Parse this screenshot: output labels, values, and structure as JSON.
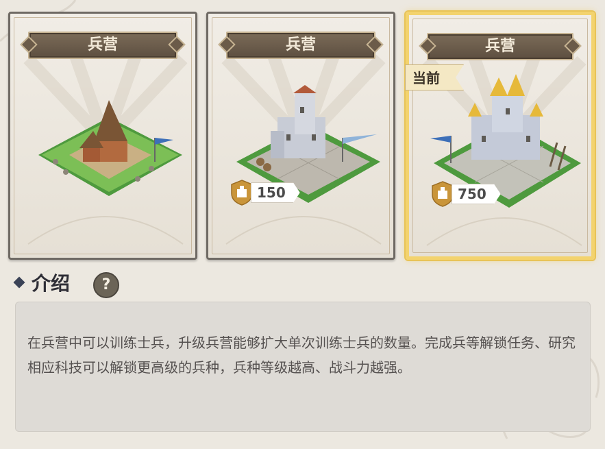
{
  "cards": [
    {
      "title": "兵营",
      "building": "barracks-level-1-icon",
      "cost": null,
      "current": false
    },
    {
      "title": "兵营",
      "building": "barracks-level-2-icon",
      "cost": "150",
      "current": false
    },
    {
      "title": "兵营",
      "building": "barracks-level-3-icon",
      "cost": "750",
      "current": true
    }
  ],
  "current_tag": "当前",
  "intro": {
    "title": "介绍",
    "help": "?",
    "text": "在兵营中可以训练士兵，升级兵营能够扩大单次训练士兵的数量。完成兵等解锁任务、研究相应科技可以解锁更高级的兵种，兵种等级越高、战斗力越强。"
  },
  "colors": {
    "current_border": "#f3d36e",
    "banner": "#6b5b49",
    "background": "#ece8e0",
    "shield": "#c9953a"
  }
}
